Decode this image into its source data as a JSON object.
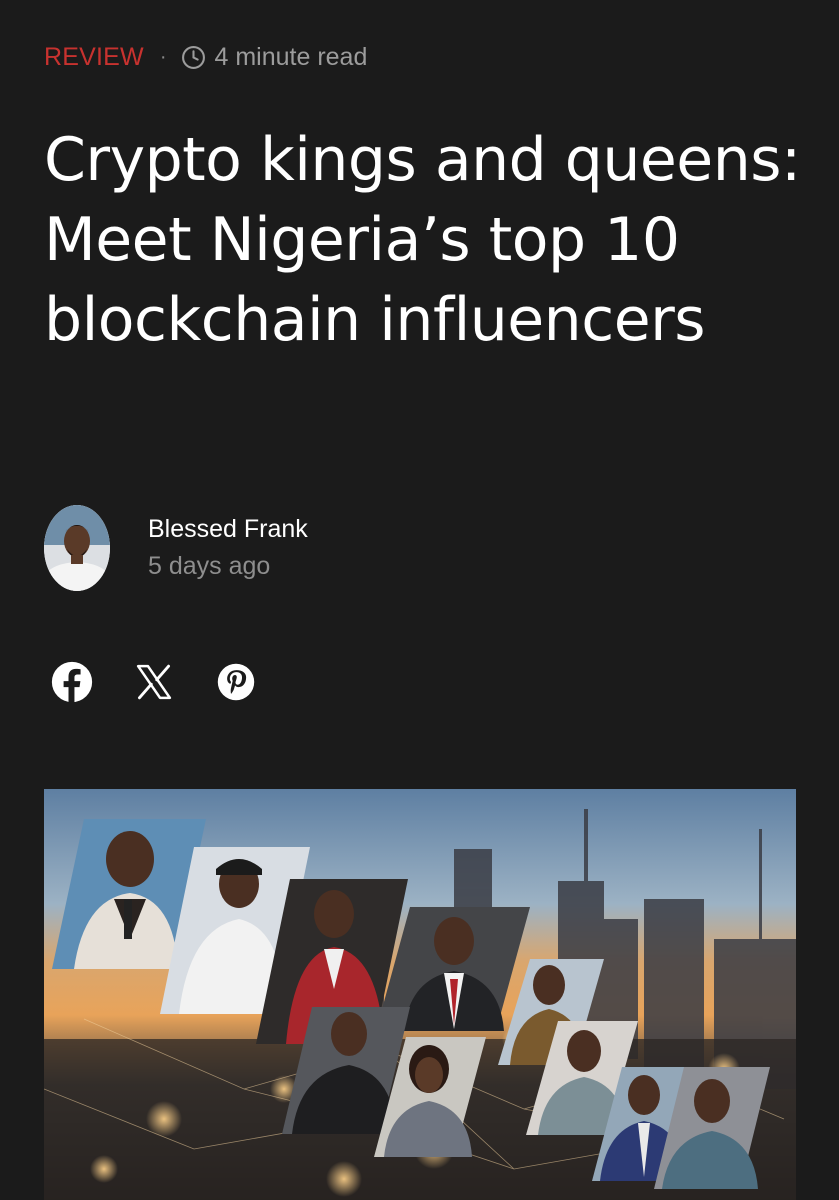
{
  "article": {
    "category": "REVIEW",
    "separator": "·",
    "read_time": "4 minute read",
    "title": "Crypto kings and queens: Meet Nigeria’s top 10 blockchain influencers"
  },
  "author": {
    "name": "Blessed Frank",
    "date": "5 days ago"
  },
  "share": {
    "icons": [
      "facebook-icon",
      "x-icon",
      "pinterest-icon"
    ]
  },
  "hero_image": {
    "description": "collage of ten portrait photos over a blurred city skyline"
  },
  "colors": {
    "background": "#1b1b1b",
    "category": "#c8322f",
    "muted_text": "#9c9c9c",
    "text": "#ffffff"
  }
}
